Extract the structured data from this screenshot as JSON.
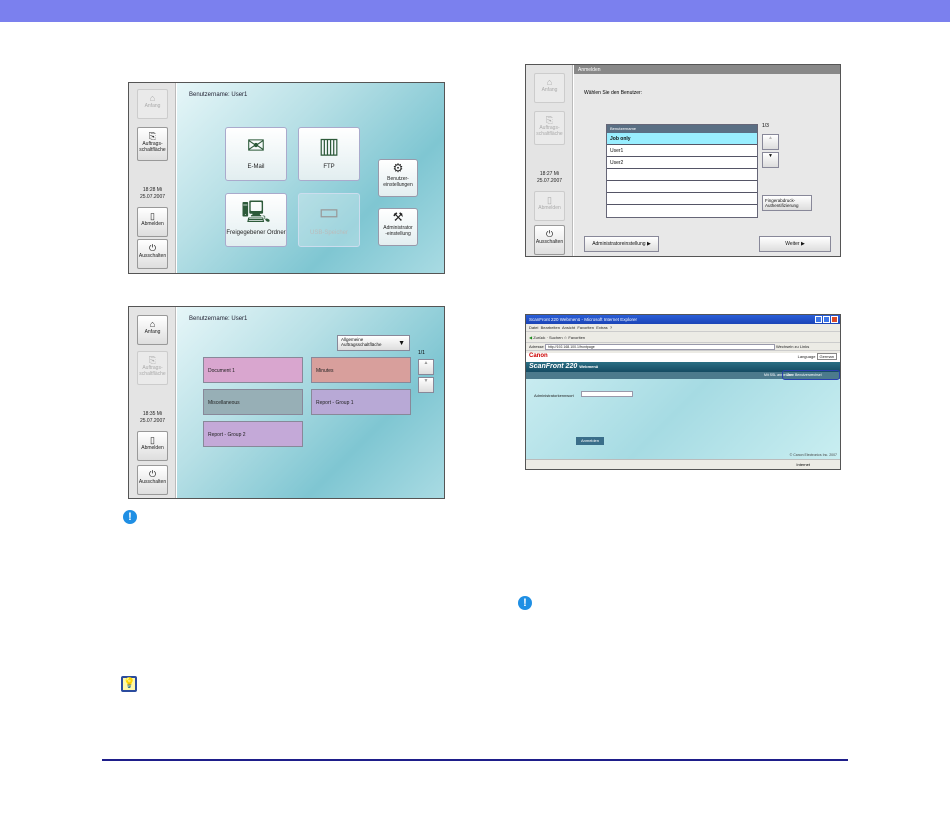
{
  "screen1": {
    "sidebar": {
      "home": "Anfang",
      "jobs": "Auftrags-\nschaltfläche",
      "time": "18:28 Mi",
      "date": "25.07.2007",
      "logout": "Abmelden",
      "shutdown": "Ausschalten"
    },
    "username": "Benutzername: User1",
    "tiles": {
      "email": "E-Mail",
      "ftp": "FTP",
      "shared": "Freigegebener Ordner",
      "usb": "USB-Speicher",
      "user_settings": "Benutzer-\neinstellungen",
      "admin_settings": "Administrator\n-einstellung"
    }
  },
  "screen2": {
    "sidebar": {
      "home": "Anfang",
      "jobs": "Auftrags-\nschaltfläche",
      "time": "18:27 Mi",
      "date": "25.07.2007",
      "logout": "Abmelden",
      "shutdown": "Ausschalten"
    },
    "dialog_title": "Anmelden",
    "prompt": "Wählen Sie den Benutzer:",
    "list_header": "Benutzername",
    "users": [
      "Job only",
      "User1",
      "User2",
      "",
      "",
      "",
      ""
    ],
    "page": "1/3",
    "fingerprint": "Fingerabdruck-\nAuthentifizierung",
    "admin_button": "Administratoreinstellung",
    "next_button": "Weiter"
  },
  "screen3": {
    "sidebar": {
      "home": "Anfang",
      "jobs": "Auftrags-\nschaltfläche",
      "time": "18:35 Mi",
      "date": "25.07.2007",
      "logout": "Abmelden",
      "shutdown": "Ausschalten"
    },
    "username": "Benutzername: User1",
    "dropdown": "Allgemeine\nAuftragsschaltfläche",
    "page": "1/1",
    "jobs": [
      {
        "label": "Document 1",
        "color": "#d9a6cf"
      },
      {
        "label": "Minutes",
        "color": "#d89f9c"
      },
      {
        "label": "Miscellaneous",
        "color": "#97afb6"
      },
      {
        "label": "Report - Group 1",
        "color": "#b8a9d6"
      },
      {
        "label": "Report - Group 2",
        "color": "#c4a9d8"
      }
    ]
  },
  "browser": {
    "title": "ScanFront 220 Webmenü - Microsoft Internet Explorer",
    "menu": [
      "Datei",
      "Bearbeiten",
      "Ansicht",
      "Favoriten",
      "Extras",
      "?"
    ],
    "toolbar": "Zurück  ·  Suchen  ☆ Favoriten",
    "address_label": "Adresse",
    "address": "http://192.168.100.1/frontpage",
    "go": "Wechseln zu",
    "links": "Links",
    "brand": "Canon",
    "language_label": "Language",
    "language_value": "German",
    "product": "ScanFront 220",
    "product_sub": "Webmenü",
    "link1": "Mit SSL anmelden",
    "link2": "Zum Benutzerwechsel",
    "password_label": "Administratorkennwort",
    "login_button": "Anmelden",
    "copyright": "© Canon Electronics Inc. 2007",
    "status_right": "Internet"
  },
  "icons": {
    "alert1": "!",
    "alert2": "!",
    "hint": "💡"
  },
  "colors": {
    "topbar": "#7b80ee",
    "rule": "#1e1e8a",
    "alert": "#1f8fe4",
    "highlight": "#2a3fb0"
  }
}
